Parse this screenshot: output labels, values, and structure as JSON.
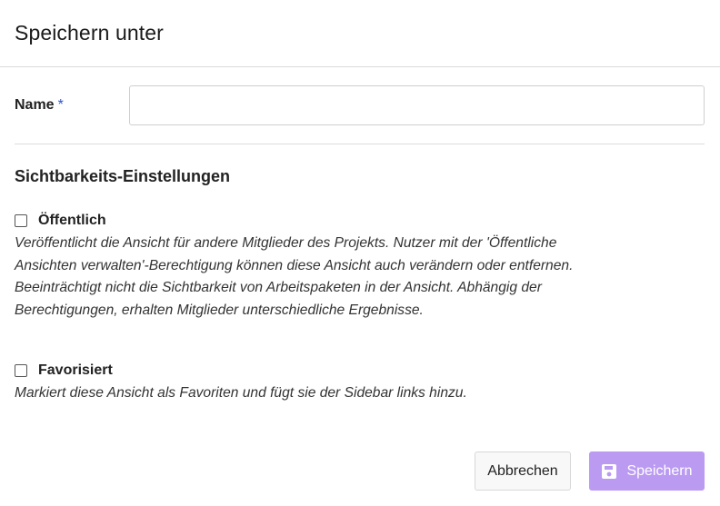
{
  "dialog": {
    "title": "Speichern unter"
  },
  "form": {
    "name_label": "Name",
    "required_marker": "*",
    "name_value": "",
    "name_placeholder": ""
  },
  "visibility": {
    "section_title": "Sichtbarkeits-Einstellungen",
    "public": {
      "label": "Öffentlich",
      "checked": false,
      "description": "Veröffentlicht die Ansicht für andere Mitglieder des Projekts. Nutzer mit der 'Öffentliche Ansichten verwalten'-Berechtigung können diese Ansicht auch verändern oder entfernen. Beeinträchtigt nicht die Sichtbarkeit von Arbeitspaketen in der Ansicht. Abhängig der Berechtigungen, erhalten Mitglieder unterschiedliche Ergebnisse."
    },
    "favorite": {
      "label": "Favorisiert",
      "checked": false,
      "description": "Markiert diese Ansicht als Favoriten und fügt sie der Sidebar links hinzu."
    }
  },
  "footer": {
    "cancel_label": "Abbrechen",
    "save_label": "Speichern",
    "save_icon": "floppy-disk-icon"
  },
  "colors": {
    "save_button_bg": "#bb9af2",
    "required_marker": "#2f53c9"
  }
}
